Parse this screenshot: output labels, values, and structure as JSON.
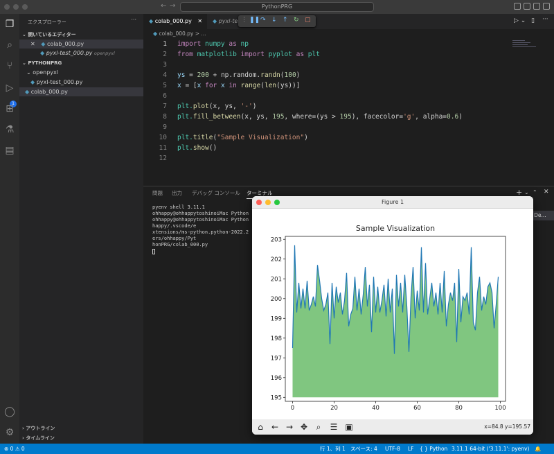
{
  "titlebar": {
    "search_text": "PythonPRG",
    "back": "←",
    "forward": "→"
  },
  "activity": {
    "debug_badge": "1"
  },
  "sidebar": {
    "title": "エクスプローラー",
    "more": "···",
    "open_editors_label": "開いているエディター",
    "open_editors": [
      {
        "close": "✕",
        "name": "colab_000.py",
        "desc": ""
      },
      {
        "close": "",
        "name": "pyxl-test_000.py",
        "desc": "openpyxl"
      }
    ],
    "project_label": "PYTHONPRG",
    "folder": "openpyxl",
    "folder_file": "pyxl-test_000.py",
    "root_file": "colab_000.py",
    "outline_label": "アウトライン",
    "timeline_label": "タイムライン"
  },
  "tabs": [
    {
      "label": "colab_000.py",
      "close": "✕"
    },
    {
      "label": "pyxl-te"
    }
  ],
  "breadcrumb": {
    "file": "colab_000.py",
    "rest": "> ..."
  },
  "code": {
    "line_numbers": [
      "1",
      "2",
      "3",
      "4",
      "5",
      "6",
      "7",
      "8",
      "9",
      "10",
      "11",
      "12"
    ],
    "l1_a": "import",
    "l1_b": " numpy ",
    "l1_c": "as",
    "l1_d": " np",
    "l2_a": "from",
    "l2_b": " matplotlib ",
    "l2_c": "import",
    "l2_d": " pyplot ",
    "l2_e": "as",
    "l2_f": " plt",
    "l4_a": "ys",
    "l4_b": " = ",
    "l4_c": "200",
    "l4_d": " + np.random.",
    "l4_e": "randn",
    "l4_f": "(",
    "l4_g": "100",
    "l4_h": ")",
    "l5_a": "x",
    "l5_b": " = [",
    "l5_c": "x",
    "l5_d": " ",
    "l5_e": "for",
    "l5_f": " x ",
    "l5_g": "in",
    "l5_h": " ",
    "l5_i": "range",
    "l5_j": "(",
    "l5_k": "len",
    "l5_l": "(ys))]",
    "l7_a": "plt.",
    "l7_b": "plot",
    "l7_c": "(x, ys, ",
    "l7_d": "'-'",
    "l7_e": ")",
    "l8_a": "plt.",
    "l8_b": "fill_between",
    "l8_c": "(x, ys, ",
    "l8_d": "195",
    "l8_e": ", where=(ys > ",
    "l8_f": "195",
    "l8_g": "), facecolor=",
    "l8_h": "'g'",
    "l8_i": ", alpha=",
    "l8_j": "0.6",
    "l8_k": ")",
    "l10_a": "plt.",
    "l10_b": "title",
    "l10_c": "(",
    "l10_d": "\"Sample Visualization\"",
    "l10_e": ")",
    "l11_a": "plt.",
    "l11_b": "show",
    "l11_c": "()"
  },
  "panel": {
    "tabs": [
      "問題",
      "出力",
      "デバッグ コンソール",
      "ターミナル"
    ],
    "terminal_lines": [
      "pyenv shell 3.11.1",
      "ohhappy@ohhappytoshinoiMac Python",
      "ohhappy@ohhappytoshinoiMac Python",
      "happy/.vscode/e",
      "xtensions/ms-python.python-2022.2",
      "ers/ohhappy/Pyt",
      "honPRG/colab_000.py"
    ],
    "side_label": "n De..."
  },
  "statusbar": {
    "errors": "⊗ 0 ⚠ 0",
    "position": "行 1、列 1",
    "spaces": "スペース: 4",
    "encoding": "UTF-8",
    "eol": "LF",
    "language": "{ } Python",
    "interpreter": "3.11.1 64-bit ('3.11.1': pyenv)"
  },
  "figure": {
    "window_title": "Figure 1",
    "coords": "x=84.8 y=195.57"
  },
  "chart_data": {
    "type": "line",
    "title": "Sample Visualization",
    "xlabel": "",
    "ylabel": "",
    "xlim": [
      -3.5,
      102.5
    ],
    "ylim": [
      194.8,
      203.15
    ],
    "xticks": [
      0,
      20,
      40,
      60,
      80,
      100
    ],
    "yticks": [
      195,
      196,
      197,
      198,
      199,
      200,
      201,
      202,
      203
    ],
    "fill_baseline": 195,
    "line_color": "#1f77b4",
    "fill_color": "#2ca02c",
    "fill_alpha": 0.6,
    "series": [
      {
        "values": [
          197.5,
          202.7,
          199.3,
          200.8,
          199.5,
          200.5,
          199.5,
          200.9,
          199.4,
          199.7,
          200.1,
          199.6,
          201.7,
          200.9,
          200.0,
          199.4,
          199.7,
          200.3,
          197.7,
          200.8,
          199.0,
          200.6,
          199.8,
          200.3,
          199.2,
          199.9,
          201.3,
          198.6,
          199.2,
          199.5,
          201.1,
          199.4,
          200.5,
          199.2,
          200.2,
          201.6,
          199.6,
          200.7,
          198.3,
          201.1,
          199.3,
          200.6,
          199.3,
          199.9,
          200.7,
          199.1,
          201.0,
          199.3,
          200.5,
          197.2,
          201.2,
          199.6,
          200.8,
          199.3,
          201.2,
          199.6,
          197.3,
          200.1,
          201.6,
          199.0,
          200.4,
          199.4,
          202.6,
          199.3,
          201.8,
          199.2,
          200.0,
          200.8,
          199.6,
          200.3,
          199.2,
          200.8,
          199.3,
          201.4,
          198.6,
          199.7,
          200.3,
          199.9,
          200.8,
          197.8,
          201.5,
          198.8,
          200.1,
          199.9,
          200.3,
          199.2,
          202.6,
          198.8,
          198.4,
          200.3,
          201.1,
          199.4,
          200.1,
          199.7,
          200.6,
          200.8,
          200.3,
          198.5,
          199.7,
          201.1
        ]
      }
    ]
  }
}
